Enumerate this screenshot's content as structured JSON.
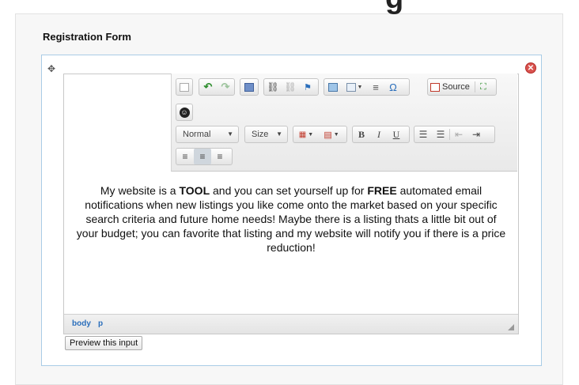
{
  "header": {
    "heading_fragment": "g"
  },
  "form": {
    "title": "Registration Form"
  },
  "field": {
    "move_icon": "move-icon",
    "remove_icon": "remove-icon",
    "preview_label": "Preview this input"
  },
  "editor": {
    "toolbar": {
      "source_label": "Source",
      "format_combo": "Normal",
      "size_combo": "Size",
      "bold": "B",
      "italic": "I",
      "underline": "U",
      "special_char": "Ω"
    },
    "content": {
      "p1": "My website is a ",
      "b1": "TOOL",
      "p2": " and you can set yourself up for ",
      "b2": "FREE",
      "p3": " automated email notifications when new listings you like come onto the market based on your specific search criteria and future home needs! Maybe there is a listing thats a little bit out of your budget; you can favorite that listing and my website will notify you if there is a price reduction!"
    },
    "path": [
      "body",
      "p"
    ]
  },
  "colors": {
    "remove": "#d9534f",
    "field_border": "#a9cce6",
    "path_link": "#2a6ebb"
  }
}
